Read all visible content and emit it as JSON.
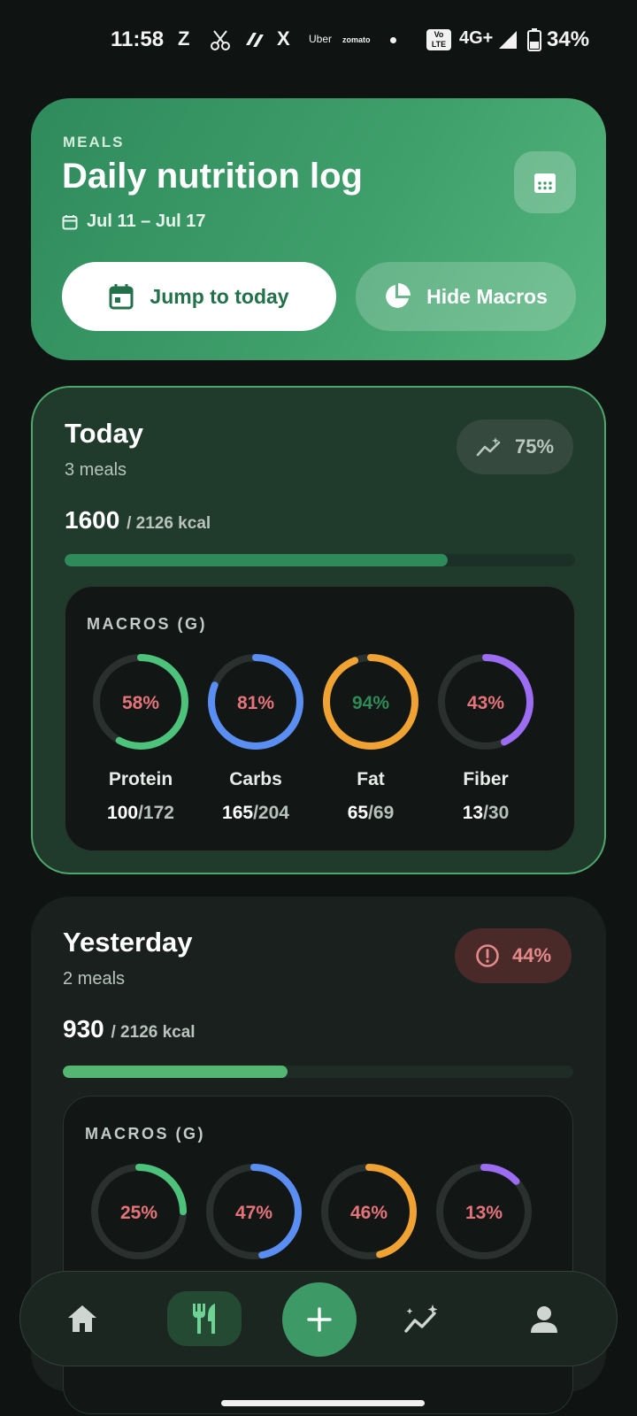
{
  "status_bar": {
    "time": "11:58",
    "apps": [
      "Z",
      "X"
    ],
    "uber": "Uber",
    "zomato": "zomato",
    "volte": "Vo\nLTE",
    "network": "4G+",
    "battery": "34%"
  },
  "header": {
    "eyebrow": "MEALS",
    "title": "Daily nutrition log",
    "date_range": "Jul 11 – Jul 17",
    "jump_today_label": "Jump to today",
    "hide_macros_label": "Hide Macros"
  },
  "days": [
    {
      "title": "Today",
      "meals": "3 meals",
      "kcal": "1600",
      "kcal_goal": "/ 2126 kcal",
      "progress": 0.75,
      "badge": "75%",
      "badge_icon": "trend-sparkle-icon",
      "macros_label": "MACROS (G)",
      "macros": [
        {
          "pct": "58%",
          "fraction": 0.58,
          "name": "Protein",
          "value": "100",
          "target": "/172",
          "ring_color": "#4cc27a",
          "pct_color": "#e5737a"
        },
        {
          "pct": "81%",
          "fraction": 0.81,
          "name": "Carbs",
          "value": "165",
          "target": "/204",
          "ring_color": "#5a8ef2",
          "pct_color": "#e5737a"
        },
        {
          "pct": "94%",
          "fraction": 0.94,
          "name": "Fat",
          "value": "65",
          "target": "/69",
          "ring_color": "#f0a332",
          "pct_color": "#2f8a55"
        },
        {
          "pct": "43%",
          "fraction": 0.43,
          "name": "Fiber",
          "value": "13",
          "target": "/30",
          "ring_color": "#9c6df2",
          "pct_color": "#e5737a"
        }
      ]
    },
    {
      "title": "Yesterday",
      "meals": "2 meals",
      "kcal": "930",
      "kcal_goal": "/ 2126 kcal",
      "progress": 0.44,
      "badge": "44%",
      "badge_icon": "alert-circle-icon",
      "macros_label": "MACROS (G)",
      "macros": [
        {
          "pct": "25%",
          "fraction": 0.25,
          "ring_color": "#4cc27a",
          "pct_color": "#e5737a"
        },
        {
          "pct": "47%",
          "fraction": 0.47,
          "ring_color": "#5a8ef2",
          "pct_color": "#e5737a"
        },
        {
          "pct": "46%",
          "fraction": 0.46,
          "ring_color": "#f0a332",
          "pct_color": "#e5737a"
        },
        {
          "pct": "13%",
          "fraction": 0.13,
          "ring_color": "#9c6df2",
          "pct_color": "#e5737a"
        }
      ]
    }
  ],
  "bottom_nav": {
    "items": [
      "home-icon",
      "meals-icon",
      "add-icon",
      "trends-icon",
      "profile-icon"
    ],
    "active": "meals-icon"
  },
  "colors": {
    "accent": "#3d9a66",
    "progress_today": "#2e8a58",
    "progress_yesterday": "#55b573"
  }
}
